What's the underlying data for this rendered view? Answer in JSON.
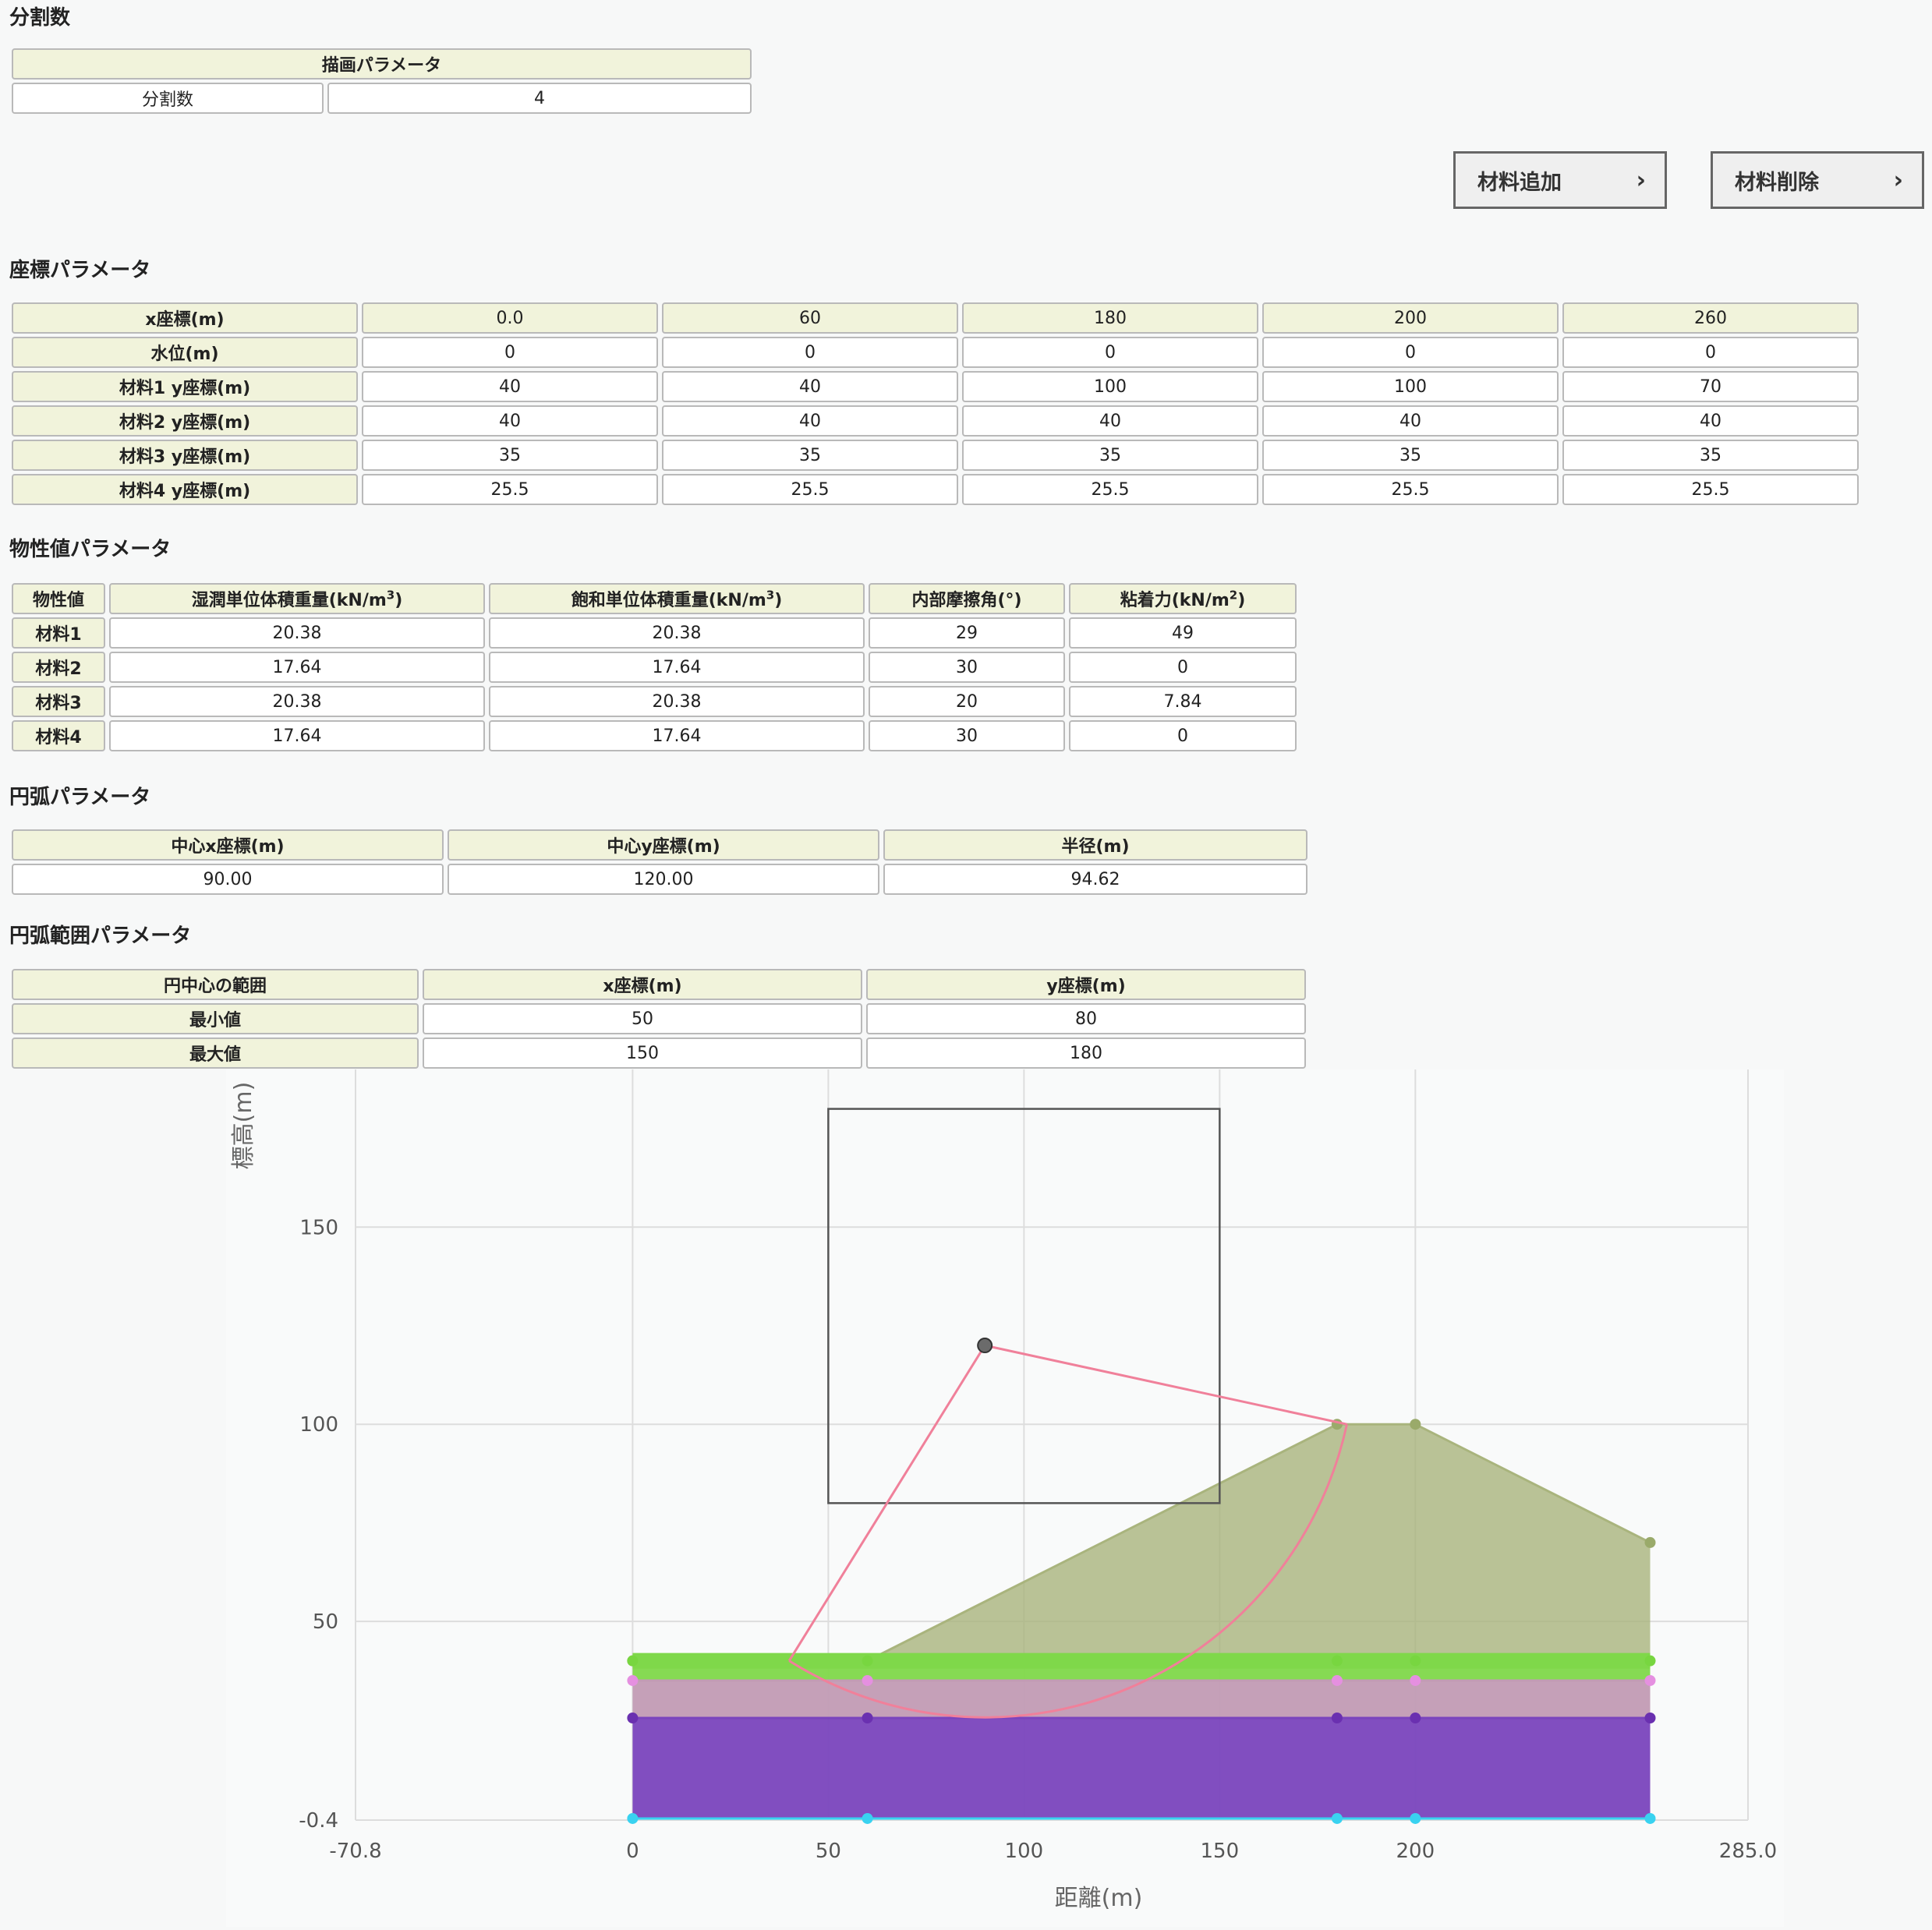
{
  "division": {
    "title": "分割数",
    "table_header": "描画パラメータ",
    "label": "分割数",
    "value": "4"
  },
  "buttons": {
    "add_material": "材料追加",
    "delete_material": "材料削除",
    "chevron": "›"
  },
  "coords": {
    "title": "座標パラメータ",
    "rows": [
      {
        "label": "x座標(m)",
        "values": [
          "0.0",
          "60",
          "180",
          "200",
          "260"
        ]
      },
      {
        "label": "水位(m)",
        "values": [
          "0",
          "0",
          "0",
          "0",
          "0"
        ]
      },
      {
        "label": "材料1 y座標(m)",
        "values": [
          "40",
          "40",
          "100",
          "100",
          "70"
        ]
      },
      {
        "label": "材料2 y座標(m)",
        "values": [
          "40",
          "40",
          "40",
          "40",
          "40"
        ]
      },
      {
        "label": "材料3 y座標(m)",
        "values": [
          "35",
          "35",
          "35",
          "35",
          "35"
        ]
      },
      {
        "label": "材料4 y座標(m)",
        "values": [
          "25.5",
          "25.5",
          "25.5",
          "25.5",
          "25.5"
        ]
      }
    ]
  },
  "props": {
    "title": "物性値パラメータ",
    "headers": [
      "物性値",
      "湿潤単位体積重量(kN/m",
      "飽和単位体積重量(kN/m",
      "内部摩擦角(°)",
      "粘着力(kN/m"
    ],
    "header_sups": [
      "3",
      "3",
      "2"
    ],
    "header_close": ")",
    "rows": [
      {
        "label": "材料1",
        "values": [
          "20.38",
          "20.38",
          "29",
          "49"
        ]
      },
      {
        "label": "材料2",
        "values": [
          "17.64",
          "17.64",
          "30",
          "0"
        ]
      },
      {
        "label": "材料3",
        "values": [
          "20.38",
          "20.38",
          "20",
          "7.84"
        ]
      },
      {
        "label": "材料4",
        "values": [
          "17.64",
          "17.64",
          "30",
          "0"
        ]
      }
    ]
  },
  "arc": {
    "title": "円弧パラメータ",
    "headers": [
      "中心x座標(m)",
      "中心y座標(m)",
      "半径(m)"
    ],
    "values": [
      "90.00",
      "120.00",
      "94.62"
    ]
  },
  "arc_range": {
    "title": "円弧範囲パラメータ",
    "headers": [
      "円中心の範囲",
      "x座標(m)",
      "y座標(m)"
    ],
    "rows": [
      {
        "label": "最小値",
        "values": [
          "50",
          "80"
        ]
      },
      {
        "label": "最大値",
        "values": [
          "150",
          "180"
        ]
      }
    ]
  },
  "chart_data": {
    "type": "area",
    "xlabel": "距離(m)",
    "ylabel": "標高(m)",
    "xlim": [
      -70.8,
      285.0
    ],
    "ylim": [
      -0.4,
      190
    ],
    "x_ticks": [
      "-70.8",
      "0",
      "50",
      "100",
      "150",
      "200",
      "285.0"
    ],
    "x_tick_values": [
      -70.8,
      0,
      50,
      100,
      150,
      200,
      285.0
    ],
    "y_ticks": [
      "-0.4",
      "50",
      "100",
      "150"
    ],
    "y_tick_values": [
      -0.4,
      50,
      100,
      150
    ],
    "grid": true,
    "x": [
      0,
      60,
      180,
      200,
      260
    ],
    "series": [
      {
        "values": [
          40,
          40,
          100,
          100,
          70
        ],
        "color": "#a9b47d",
        "point_color": "#9aaa6a"
      },
      {
        "values": [
          40,
          40,
          40,
          40,
          40
        ],
        "color": "#7fd84a",
        "point_color": "#78d640"
      },
      {
        "values": [
          35,
          35,
          35,
          35,
          35
        ],
        "color": "#c29bb4",
        "point_color": "#e590e0"
      },
      {
        "values": [
          25.5,
          25.5,
          25.5,
          25.5,
          25.5
        ],
        "color": "#7a44bd",
        "point_color": "#6a30b0"
      },
      {
        "values": [
          0,
          0,
          0,
          0,
          0
        ],
        "color": "#39d2f0",
        "point_color": "#39d2f0"
      }
    ],
    "search_range": {
      "x_min": 50,
      "x_max": 150,
      "y_min": 80,
      "y_max": 180
    },
    "circle": {
      "cx": 90,
      "cy": 120,
      "r": 94.62,
      "color": "#f0809a",
      "entry": [
        40,
        40
      ],
      "exit": [
        182.5,
        100
      ]
    }
  }
}
